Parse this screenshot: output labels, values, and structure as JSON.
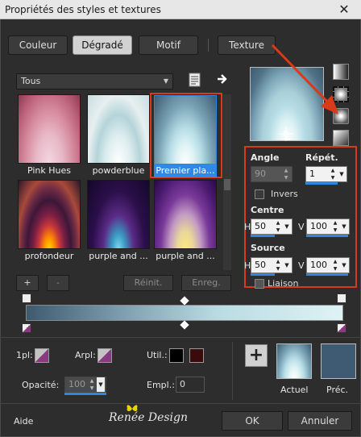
{
  "window": {
    "title": "Propriétés des styles et textures",
    "close": "✕"
  },
  "tabs": [
    {
      "label": "Couleur"
    },
    {
      "label": "Dégradé"
    },
    {
      "label": "Motif"
    },
    {
      "label": "Texture"
    }
  ],
  "category": {
    "value": "Tous"
  },
  "gradients": [
    {
      "label": "Pink Hues"
    },
    {
      "label": "powderblue"
    },
    {
      "label": "Premier pla..."
    },
    {
      "label": "profondeur"
    },
    {
      "label": "purple and ..."
    },
    {
      "label": "purple and ..."
    }
  ],
  "list_buttons": {
    "add": "+",
    "remove": "-",
    "reset": "Réinit.",
    "save": "Enreg."
  },
  "settings": {
    "angle_label": "Angle",
    "angle_value": "90",
    "repeat_label": "Répét.",
    "repeat_value": "1",
    "invert_label": "Invers",
    "center_label": "Centre",
    "center_h_label": "H",
    "center_h_value": "50",
    "center_v_label": "V",
    "center_v_value": "100",
    "source_label": "Source",
    "source_h_label": "H",
    "source_h_value": "50",
    "source_v_label": "V",
    "source_v_value": "100",
    "link_label": "Liaison"
  },
  "stops": {
    "fg_label": "1pl:",
    "bg_label": "Arpl:",
    "user_label": "Util.:",
    "opacity_label": "Opacité:",
    "opacity_value": "100",
    "location_label": "Empl.:",
    "location_value": "0"
  },
  "current": {
    "current_label": "Actuel",
    "previous_label": "Préc."
  },
  "footer": {
    "help": "Aide",
    "brand": "Renée Design",
    "ok": "OK",
    "cancel": "Annuler"
  },
  "colors": {
    "accent": "#2e86de",
    "highlight": "#d83a1a",
    "user_color_1": "#000000",
    "user_color_2": "#3a0b0b",
    "previous_swatch": "#3f5a73"
  }
}
